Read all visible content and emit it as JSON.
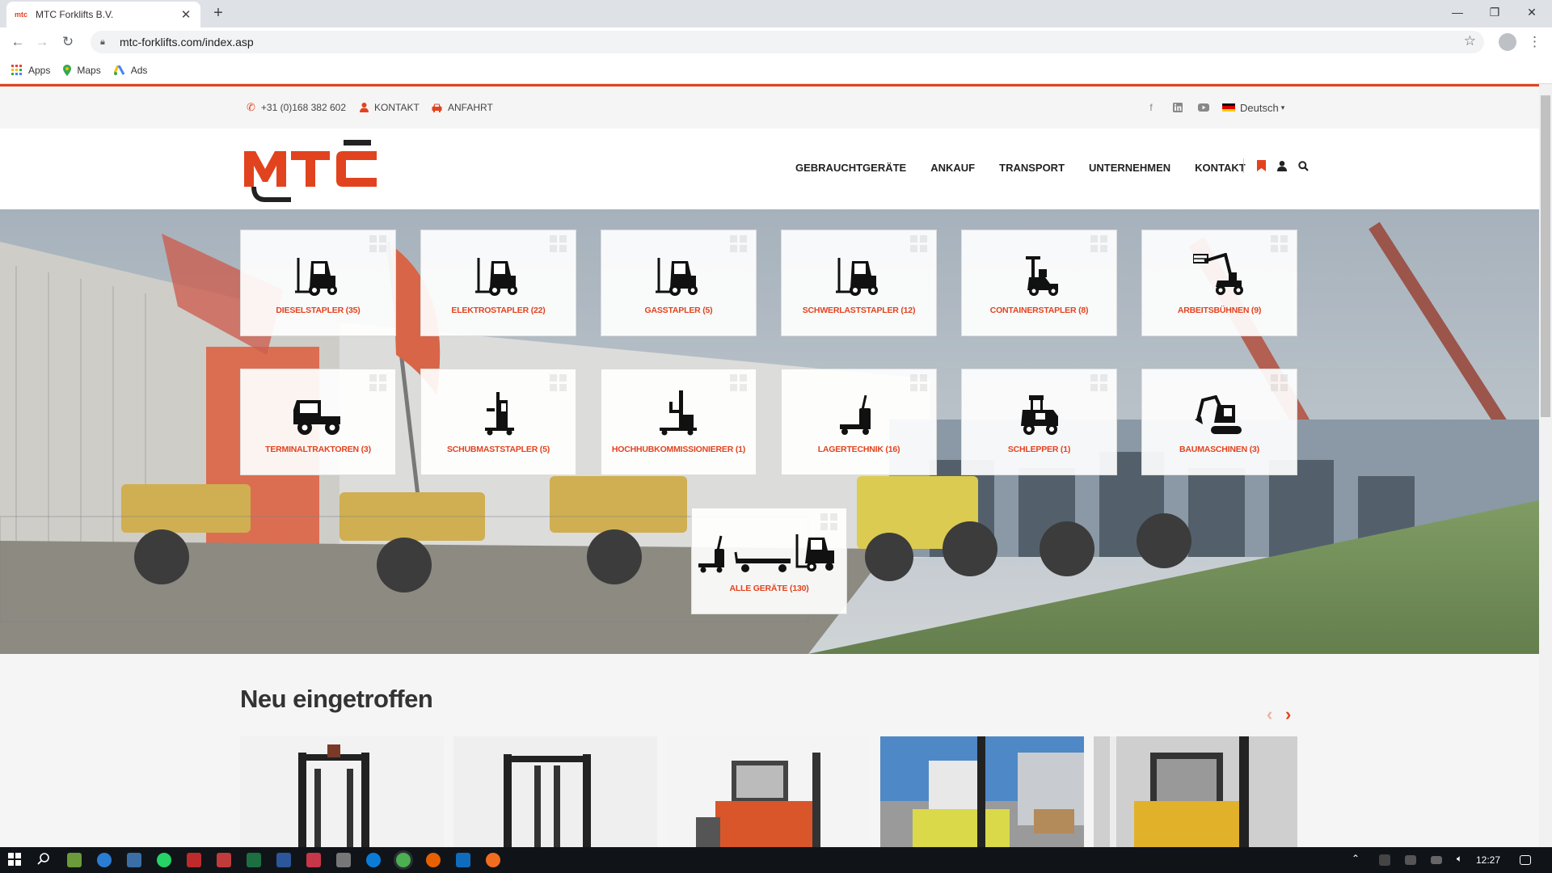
{
  "browser": {
    "tab_title": "MTC Forklifts B.V.",
    "url": "mtc-forklifts.com/index.asp",
    "bookmarks": [
      "Apps",
      "Maps",
      "Ads"
    ]
  },
  "topbar": {
    "phone": "+31 (0)168 382 602",
    "kontakt": "KONTAKT",
    "anfahrt": "ANFAHRT",
    "language": "Deutsch"
  },
  "nav": {
    "items": [
      "GEBRAUCHTGERÄTE",
      "ANKAUF",
      "TRANSPORT",
      "UNTERNEHMEN",
      "KONTAKT"
    ]
  },
  "categories": {
    "row1": [
      {
        "label": "DIESELSTAPLER (35)",
        "icon": "forklift-icon"
      },
      {
        "label": "ELEKTROSTAPLER (22)",
        "icon": "forklift-icon"
      },
      {
        "label": "GASSTAPLER (5)",
        "icon": "forklift-icon"
      },
      {
        "label": "SCHWERLASTSTAPLER (12)",
        "icon": "forklift-icon"
      },
      {
        "label": "CONTAINERSTAPLER (8)",
        "icon": "container-handler-icon"
      },
      {
        "label": "ARBEITSBÜHNEN (9)",
        "icon": "aerial-platform-icon"
      }
    ],
    "row2": [
      {
        "label": "TERMINALTRAKTOREN (3)",
        "icon": "terminal-tractor-icon"
      },
      {
        "label": "SCHUBMASTSTAPLER (5)",
        "icon": "reach-truck-icon"
      },
      {
        "label": "HOCHHUBKOMMISSIONIERER (1)",
        "icon": "order-picker-icon"
      },
      {
        "label": "LAGERTECHNIK (16)",
        "icon": "pallet-truck-icon"
      },
      {
        "label": "SCHLEPPER (1)",
        "icon": "tow-tractor-icon"
      },
      {
        "label": "BAUMASCHINEN (3)",
        "icon": "excavator-icon"
      }
    ],
    "all": {
      "label": "ALLE GERÄTE (130)",
      "icon": "all-equipment-icon"
    }
  },
  "new_arrivals": {
    "title": "Neu eingetroffen"
  },
  "taskbar": {
    "time": "12:27"
  },
  "colors": {
    "accent": "#e2431f",
    "nav_text": "#222222"
  }
}
